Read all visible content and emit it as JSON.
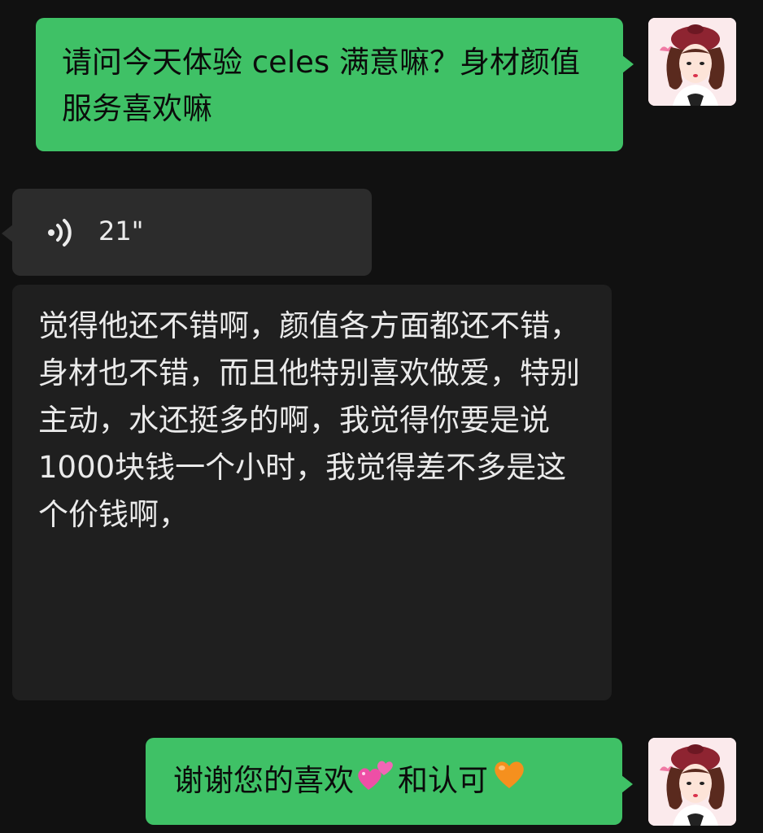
{
  "messages": [
    {
      "id": "msg1",
      "side": "outgoing",
      "text": "请问今天体验 celes 满意嘛？身材颜值服务喜欢嘛"
    },
    {
      "id": "msg2",
      "side": "incoming",
      "type": "voice",
      "duration": "21\"",
      "transcript": "觉得他还不错啊，颜值各方面都还不错，身材也不错，而且他特别喜欢做爱，特别主动，水还挺多的啊，我觉得你要是说1000块钱一个小时，我觉得差不多是这个价钱啊，"
    },
    {
      "id": "msg3",
      "side": "outgoing",
      "text_part1": "谢谢您的喜欢",
      "text_part2": "和认可",
      "emoji1": "two-hearts-icon",
      "emoji2": "orange-heart-icon"
    }
  ],
  "colors": {
    "outgoing_bubble": "#3fc166",
    "incoming_bubble": "#2c2c2c",
    "transcript_bg": "#1f1f1f",
    "background": "#111111"
  }
}
